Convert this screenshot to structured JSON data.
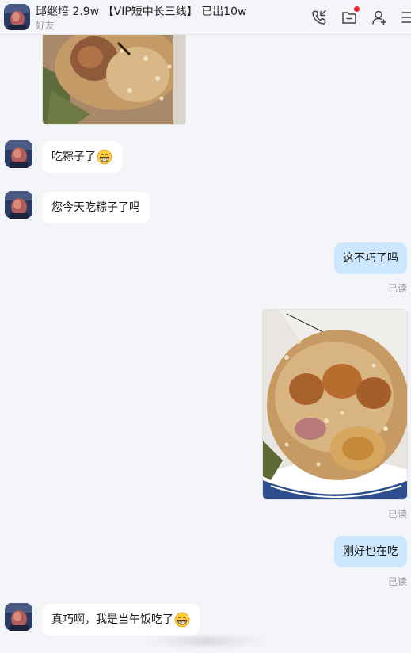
{
  "header": {
    "title": "邱继培 2.9w 【VIP短中长三线】 已出10w",
    "subtitle": "好友",
    "icons": [
      "phone-icon",
      "folder-icon",
      "add-user-icon",
      "more-menu-icon"
    ],
    "notification_color": "#f5222d"
  },
  "messages": [
    {
      "side": "in",
      "type": "image",
      "content": "粽子照片"
    },
    {
      "side": "in",
      "type": "text",
      "text": "吃粽子了",
      "emoji": "grin"
    },
    {
      "side": "in",
      "type": "text",
      "text": "您今天吃粽子了吗"
    },
    {
      "side": "out",
      "type": "text",
      "text": "这不巧了吗",
      "status": "已读"
    },
    {
      "side": "out",
      "type": "image",
      "status": "已读"
    },
    {
      "side": "out",
      "type": "text",
      "text": "刚好也在吃",
      "status": "已读"
    },
    {
      "side": "in",
      "type": "text",
      "text": "真巧啊，我是当午饭吃了",
      "emoji": "grin"
    }
  ],
  "colors": {
    "background": "#f4f5f9",
    "incoming_bubble": "#ffffff",
    "outgoing_bubble": "#cce7fd",
    "read_status": "#9a9aa0"
  }
}
